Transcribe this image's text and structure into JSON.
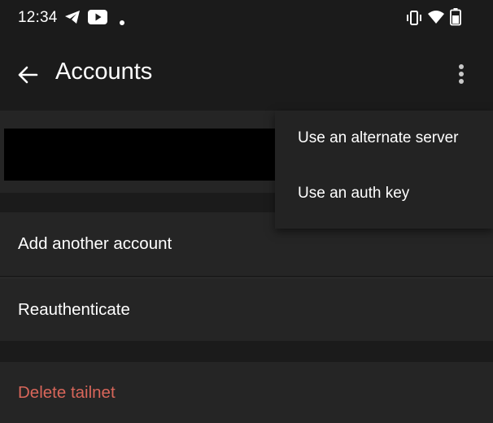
{
  "status_bar": {
    "time": "12:34",
    "icons": [
      "telegram-icon",
      "youtube-icon",
      "notification-dot-icon",
      "vibrate-icon",
      "wifi-icon",
      "battery-icon"
    ]
  },
  "app_bar": {
    "title": "Accounts",
    "back_icon": "arrow-left-icon",
    "overflow_icon": "more-vert-icon"
  },
  "account": {
    "name": ""
  },
  "actions": {
    "add_account": "Add another account",
    "reauthenticate": "Reauthenticate",
    "delete_tailnet": "Delete tailnet"
  },
  "overflow_menu": {
    "items": [
      {
        "label": "Use an alternate server"
      },
      {
        "label": "Use an auth key"
      }
    ]
  },
  "colors": {
    "background": "#1b1b1b",
    "row": "#252525",
    "menu": "#232323",
    "danger_text": "#d8665a"
  }
}
